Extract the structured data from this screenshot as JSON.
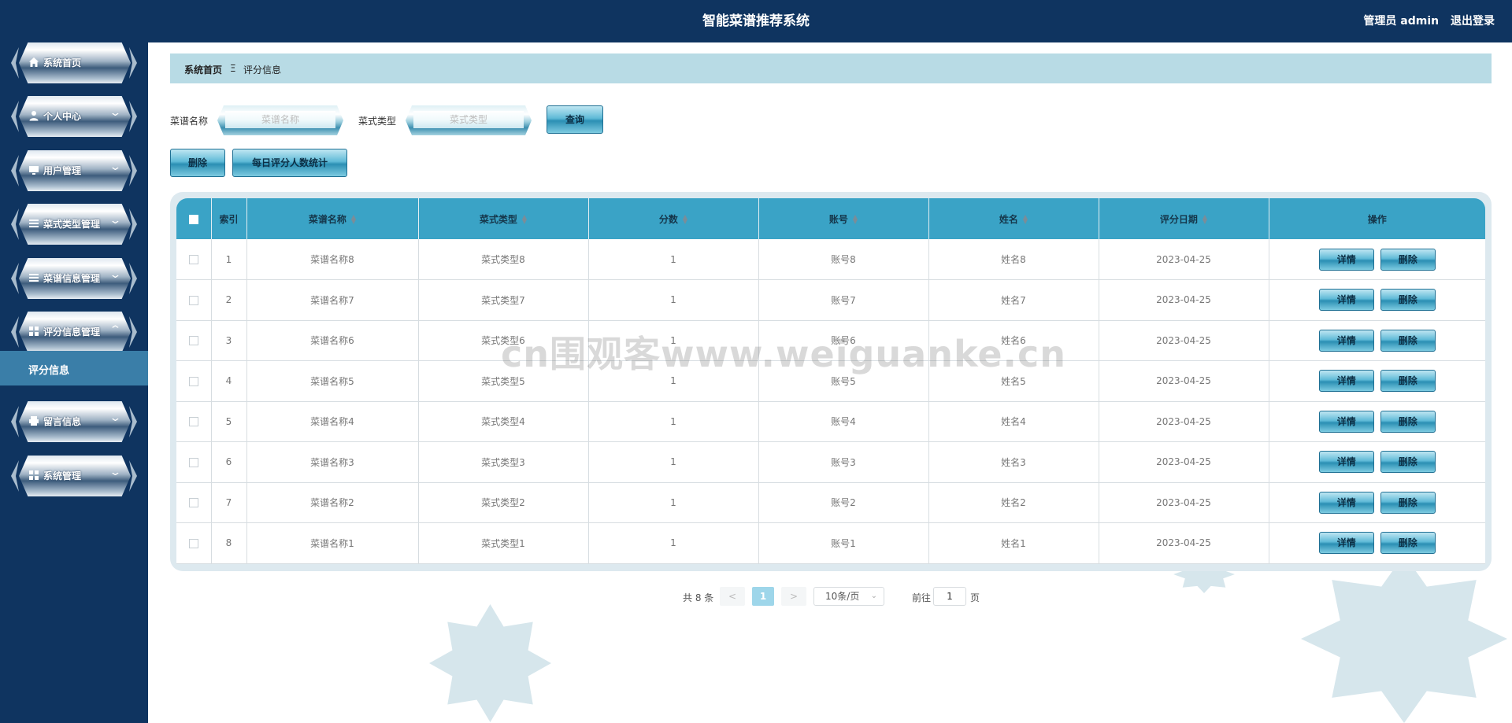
{
  "header": {
    "title": "智能菜谱推荐系统",
    "user_label": "管理员 admin",
    "logout_label": "退出登录"
  },
  "sidebar": {
    "items": [
      {
        "label": "系统首页",
        "icon": "home-icon",
        "expandable": false
      },
      {
        "label": "个人中心",
        "icon": "person-icon",
        "expandable": true
      },
      {
        "label": "用户管理",
        "icon": "monitor-icon",
        "expandable": true
      },
      {
        "label": "菜式类型管理",
        "icon": "list-icon",
        "expandable": true
      },
      {
        "label": "菜谱信息管理",
        "icon": "list-icon",
        "expandable": true
      },
      {
        "label": "评分信息管理",
        "icon": "grid-icon",
        "expandable": true,
        "expanded": true
      },
      {
        "label": "留言信息",
        "icon": "printer-icon",
        "expandable": true
      },
      {
        "label": "系统管理",
        "icon": "grid-icon",
        "expandable": true
      }
    ],
    "active_sub": "评分信息"
  },
  "breadcrumb": {
    "home": "系统首页",
    "separator": "Ξ",
    "current": "评分信息"
  },
  "search": {
    "recipe_label": "菜谱名称",
    "recipe_placeholder": "菜谱名称",
    "type_label": "菜式类型",
    "type_placeholder": "菜式类型",
    "query_button": "查询"
  },
  "actions": {
    "delete": "删除",
    "stats": "每日评分人数统计"
  },
  "table": {
    "headers": [
      "索引",
      "菜谱名称",
      "菜式类型",
      "分数",
      "账号",
      "姓名",
      "评分日期",
      "操作"
    ],
    "rows": [
      [
        "1",
        "菜谱名称8",
        "菜式类型8",
        "1",
        "账号8",
        "姓名8",
        "2023-04-25"
      ],
      [
        "2",
        "菜谱名称7",
        "菜式类型7",
        "1",
        "账号7",
        "姓名7",
        "2023-04-25"
      ],
      [
        "3",
        "菜谱名称6",
        "菜式类型6",
        "1",
        "账号6",
        "姓名6",
        "2023-04-25"
      ],
      [
        "4",
        "菜谱名称5",
        "菜式类型5",
        "1",
        "账号5",
        "姓名5",
        "2023-04-25"
      ],
      [
        "5",
        "菜谱名称4",
        "菜式类型4",
        "1",
        "账号4",
        "姓名4",
        "2023-04-25"
      ],
      [
        "6",
        "菜谱名称3",
        "菜式类型3",
        "1",
        "账号3",
        "姓名3",
        "2023-04-25"
      ],
      [
        "7",
        "菜谱名称2",
        "菜式类型2",
        "1",
        "账号2",
        "姓名2",
        "2023-04-25"
      ],
      [
        "8",
        "菜谱名称1",
        "菜式类型1",
        "1",
        "账号1",
        "姓名1",
        "2023-04-25"
      ]
    ],
    "detail_button": "详情",
    "delete_button": "删除"
  },
  "pagination": {
    "total": "共 8 条",
    "prev": "<",
    "current_page": "1",
    "next": ">",
    "page_size": "10条/页",
    "goto_label": "前往",
    "goto_value": "1",
    "page_suffix": "页"
  },
  "watermark": "cn围观客www.weiguanke.cn",
  "colors": {
    "header_bg": "#0f3460",
    "table_header": "#3aa3c6",
    "breadcrumb_bg": "#b8dbe5",
    "active_sub_bg": "#3a7ea8"
  }
}
